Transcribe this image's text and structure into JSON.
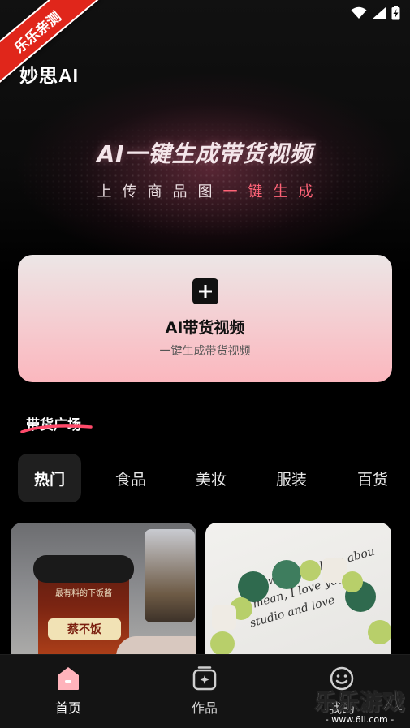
{
  "badge": {
    "text": "乐乐亲测"
  },
  "app": {
    "logo_prefix": "妙思",
    "logo_suffix": "AI"
  },
  "hero": {
    "headline": "AI一键生成带货视频",
    "sub_part1": "上传商品图",
    "sub_part2": "一键生成"
  },
  "create_card": {
    "title": "AI带货视频",
    "subtitle": "一键生成带货视频"
  },
  "section": {
    "title": "带货广场"
  },
  "tabs": [
    {
      "label": "热门"
    },
    {
      "label": "食品"
    },
    {
      "label": "美妆"
    },
    {
      "label": "服装"
    },
    {
      "label": "百货"
    }
  ],
  "feed": {
    "jar_label": "最有料的下饭酱",
    "jar_brand": "蔡不饭",
    "note_line1": "ai flowers thinking abou",
    "note_line2": "I mean, I love you.",
    "note_line3": "studio and love"
  },
  "bottom_nav": [
    {
      "label": "首页",
      "icon": "home-icon"
    },
    {
      "label": "作品",
      "icon": "works-icon"
    },
    {
      "label": "我的",
      "icon": "profile-icon"
    }
  ],
  "watermark": {
    "main": "乐乐游戏",
    "url": "- www.6ll.com -"
  },
  "colors": {
    "accent_pink": "#ff6478",
    "card_pink": "#fbb7be",
    "active_tab_bg": "#1f1f1f"
  }
}
